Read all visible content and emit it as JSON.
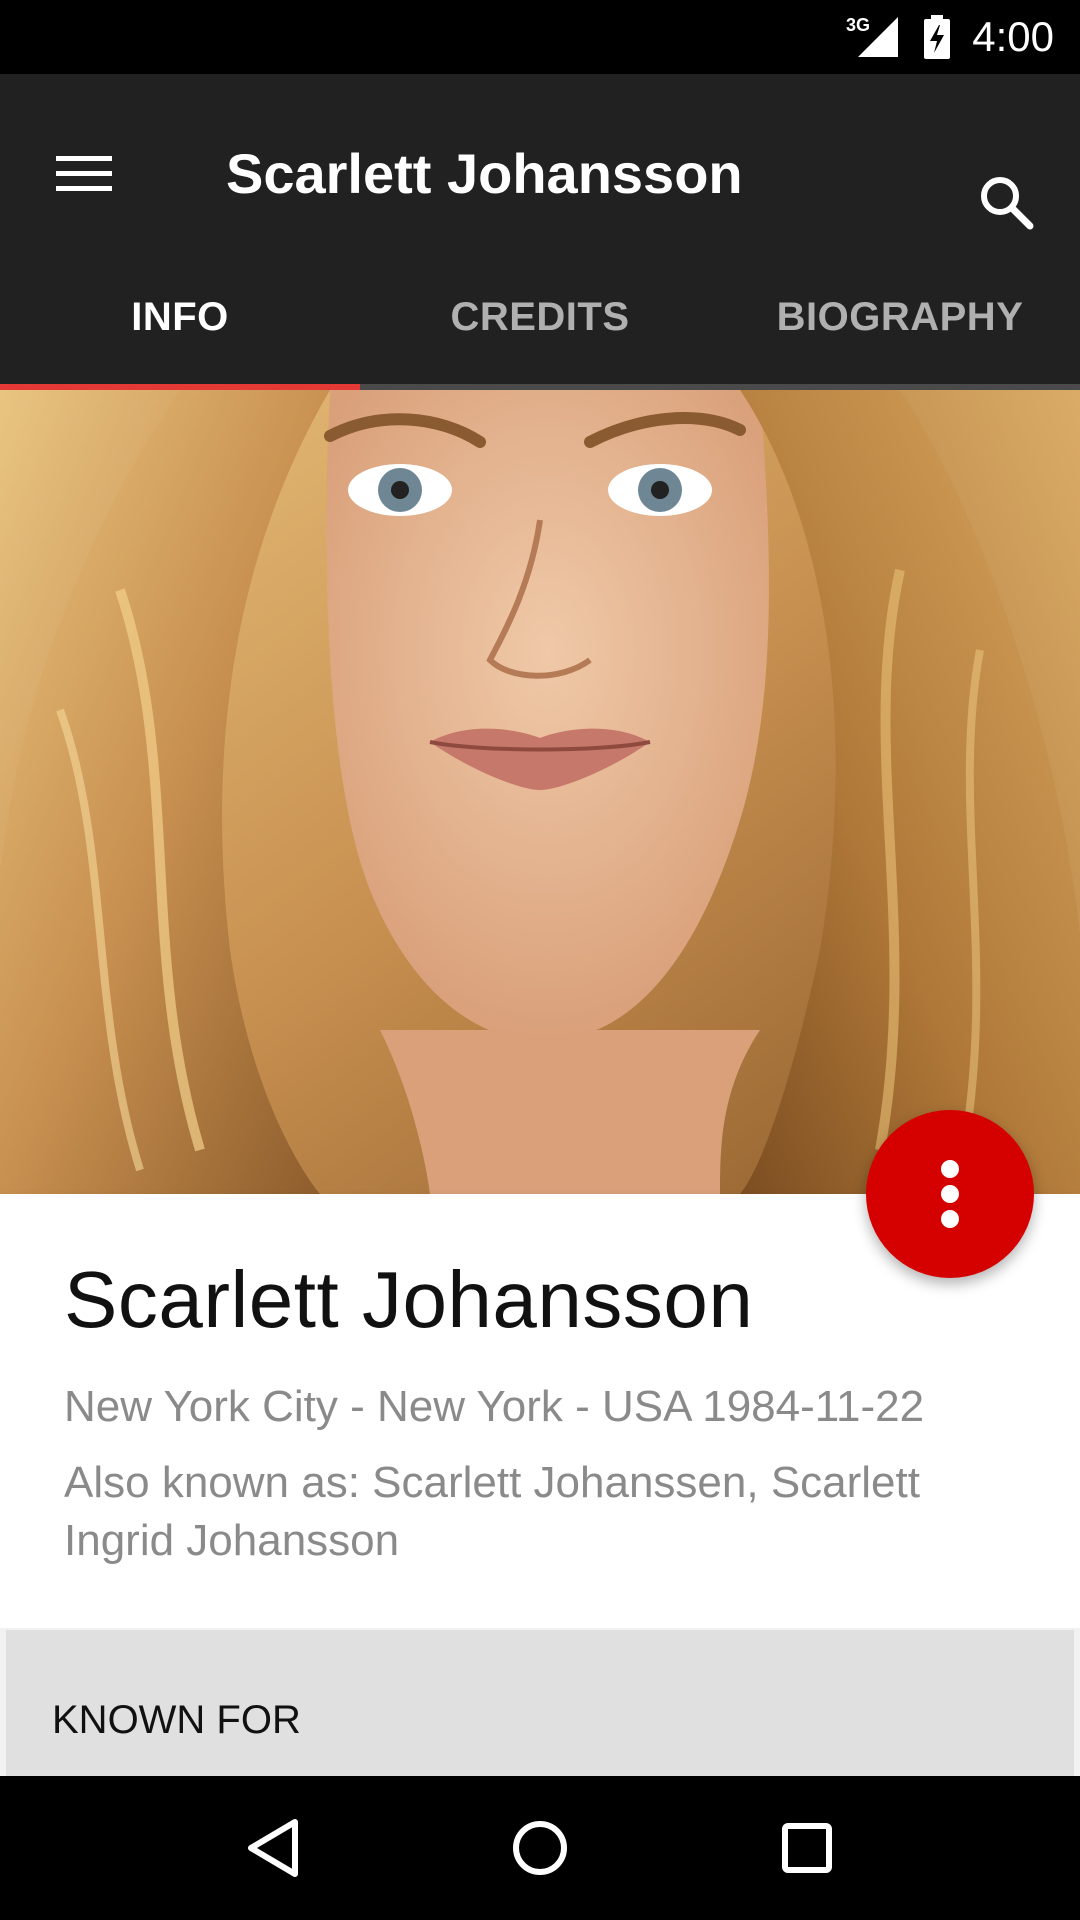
{
  "status_bar": {
    "time": "4:00",
    "network_label": "3G",
    "icons": [
      "signal-3g-icon",
      "battery-charging-icon"
    ]
  },
  "app_bar": {
    "title": "Scarlett Johansson",
    "menu_icon": "hamburger-menu-icon",
    "search_icon": "search-icon",
    "background": "#212121"
  },
  "tabs": {
    "items": [
      {
        "label": "INFO",
        "active": true
      },
      {
        "label": "CREDITS",
        "active": false
      },
      {
        "label": "BIOGRAPHY",
        "active": false
      }
    ],
    "indicator_color": "#e53935"
  },
  "hero": {
    "image": "portrait-photo"
  },
  "fab": {
    "icon": "more-vert-icon",
    "color": "#d50000"
  },
  "person": {
    "name": "Scarlett Johansson",
    "birth_info": "New York City - New York - USA 1984-11-22",
    "aka": "Also known as: Scarlett Johanssen, Scarlett Ingrid Johansson"
  },
  "known_for": {
    "label": "KNOWN FOR"
  },
  "nav_bar": {
    "icons": [
      "back-icon",
      "home-icon",
      "recents-icon"
    ]
  }
}
